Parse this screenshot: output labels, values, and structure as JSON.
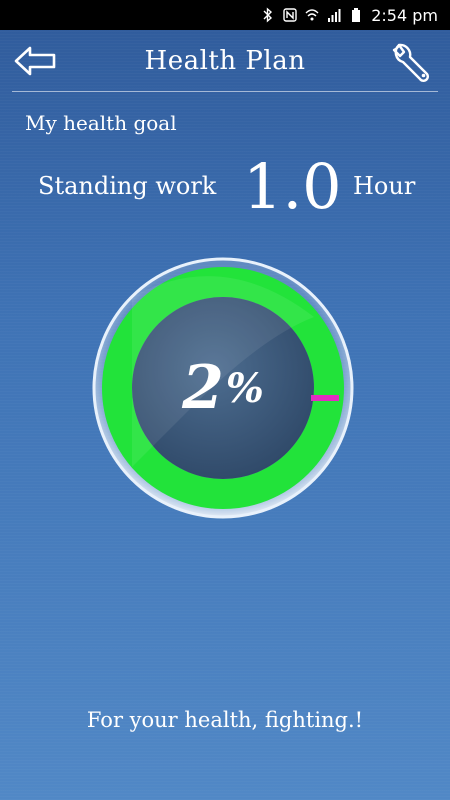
{
  "status_bar": {
    "time": "2:54 pm"
  },
  "header": {
    "title": "Health Plan",
    "back_icon": "back-arrow-icon",
    "settings_icon": "wrench-icon"
  },
  "goal": {
    "label": "My health goal",
    "activity": "Standing work",
    "value": "1.0",
    "unit": "Hour"
  },
  "progress": {
    "percent": 2,
    "number": "2",
    "sign": "%",
    "ring_color": "#22e33a",
    "marker_color": "#e22cc2"
  },
  "footer": {
    "motto": "For your health, fighting.!"
  },
  "colors": {
    "background": "#3f73b5",
    "text": "#ffffff"
  }
}
